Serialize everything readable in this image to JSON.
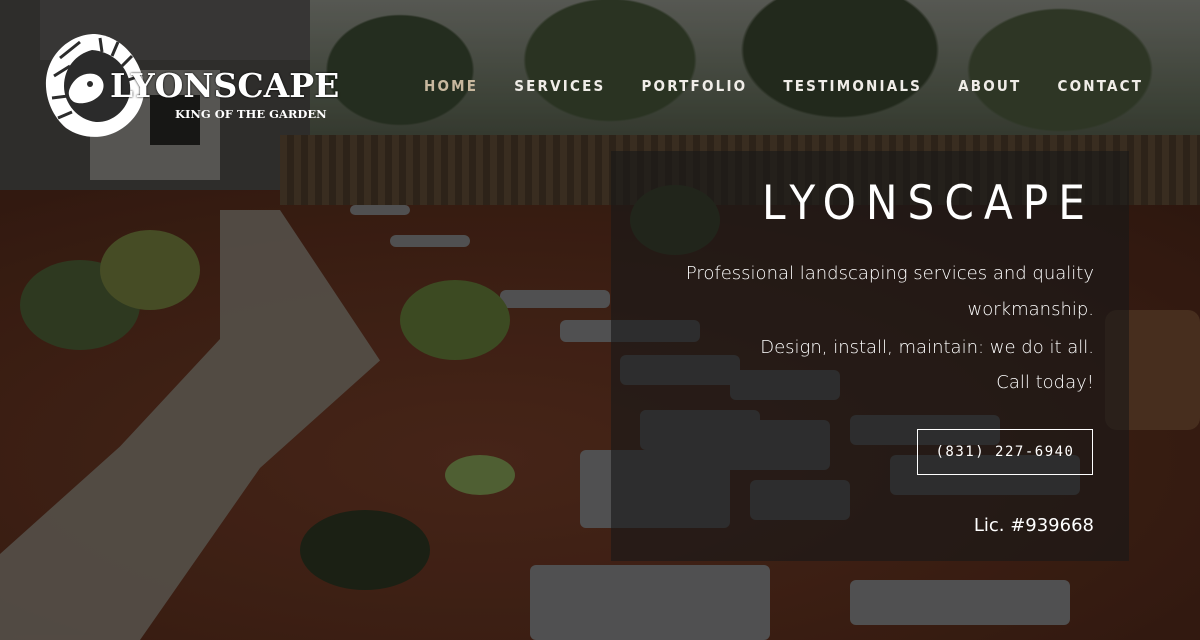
{
  "brand": {
    "name": "LYONSCAPE",
    "tagline": "KING OF THE GARDEN",
    "logo_icon": "lion-head-icon"
  },
  "nav": {
    "items": [
      {
        "label": "HOME",
        "active": true
      },
      {
        "label": "SERVICES",
        "active": false
      },
      {
        "label": "PORTFOLIO",
        "active": false
      },
      {
        "label": "TESTIMONIALS",
        "active": false
      },
      {
        "label": "ABOUT",
        "active": false
      },
      {
        "label": "CONTACT",
        "active": false
      }
    ]
  },
  "hero": {
    "title": "LYONSCAPE",
    "lines": [
      "Professional landscaping services and quality",
      "workmanship.",
      "Design, install, maintain: we do it all.",
      "Call today!"
    ],
    "phone": "(831) 227-6940",
    "license": "Lic. #939668"
  },
  "colors": {
    "nav_active": "#c8b89f",
    "nav_text": "#f0ede8",
    "panel_bg": "rgba(25,25,25,.62)",
    "text": "#ffffff"
  }
}
